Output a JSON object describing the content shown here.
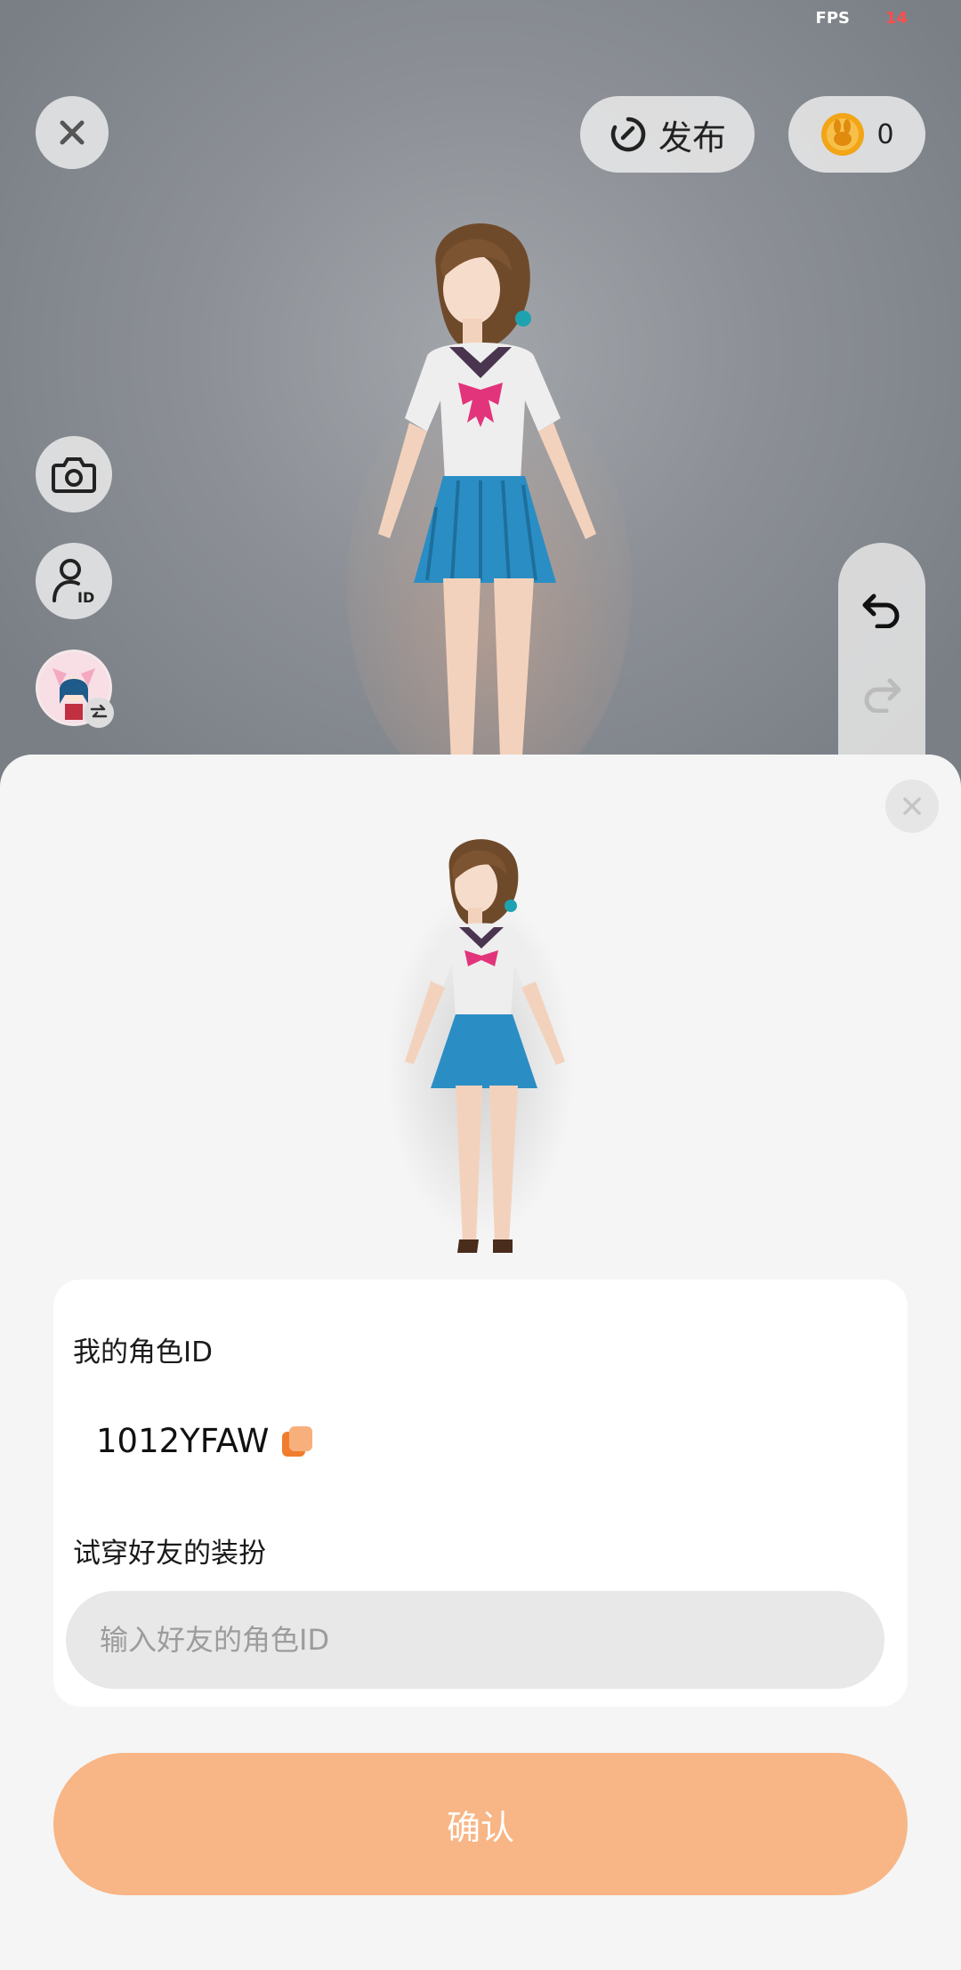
{
  "status": {
    "fps_label": "FPS",
    "fps_value": "14"
  },
  "toolbar": {
    "publish_label": "发布",
    "coin_count": "0"
  },
  "side_icons": [
    "camera-icon",
    "profile-id-icon",
    "avatar-switch"
  ],
  "sheet": {
    "my_id_label": "我的角色ID",
    "my_id_value": "1012YFAW",
    "try_on_label": "试穿好友的装扮",
    "input_placeholder": "输入好友的角色ID",
    "input_value": "",
    "confirm_label": "确认"
  },
  "colors": {
    "accent": "#f8b585",
    "coin": "#f2a516",
    "copy_icon": "#f07d2d"
  }
}
